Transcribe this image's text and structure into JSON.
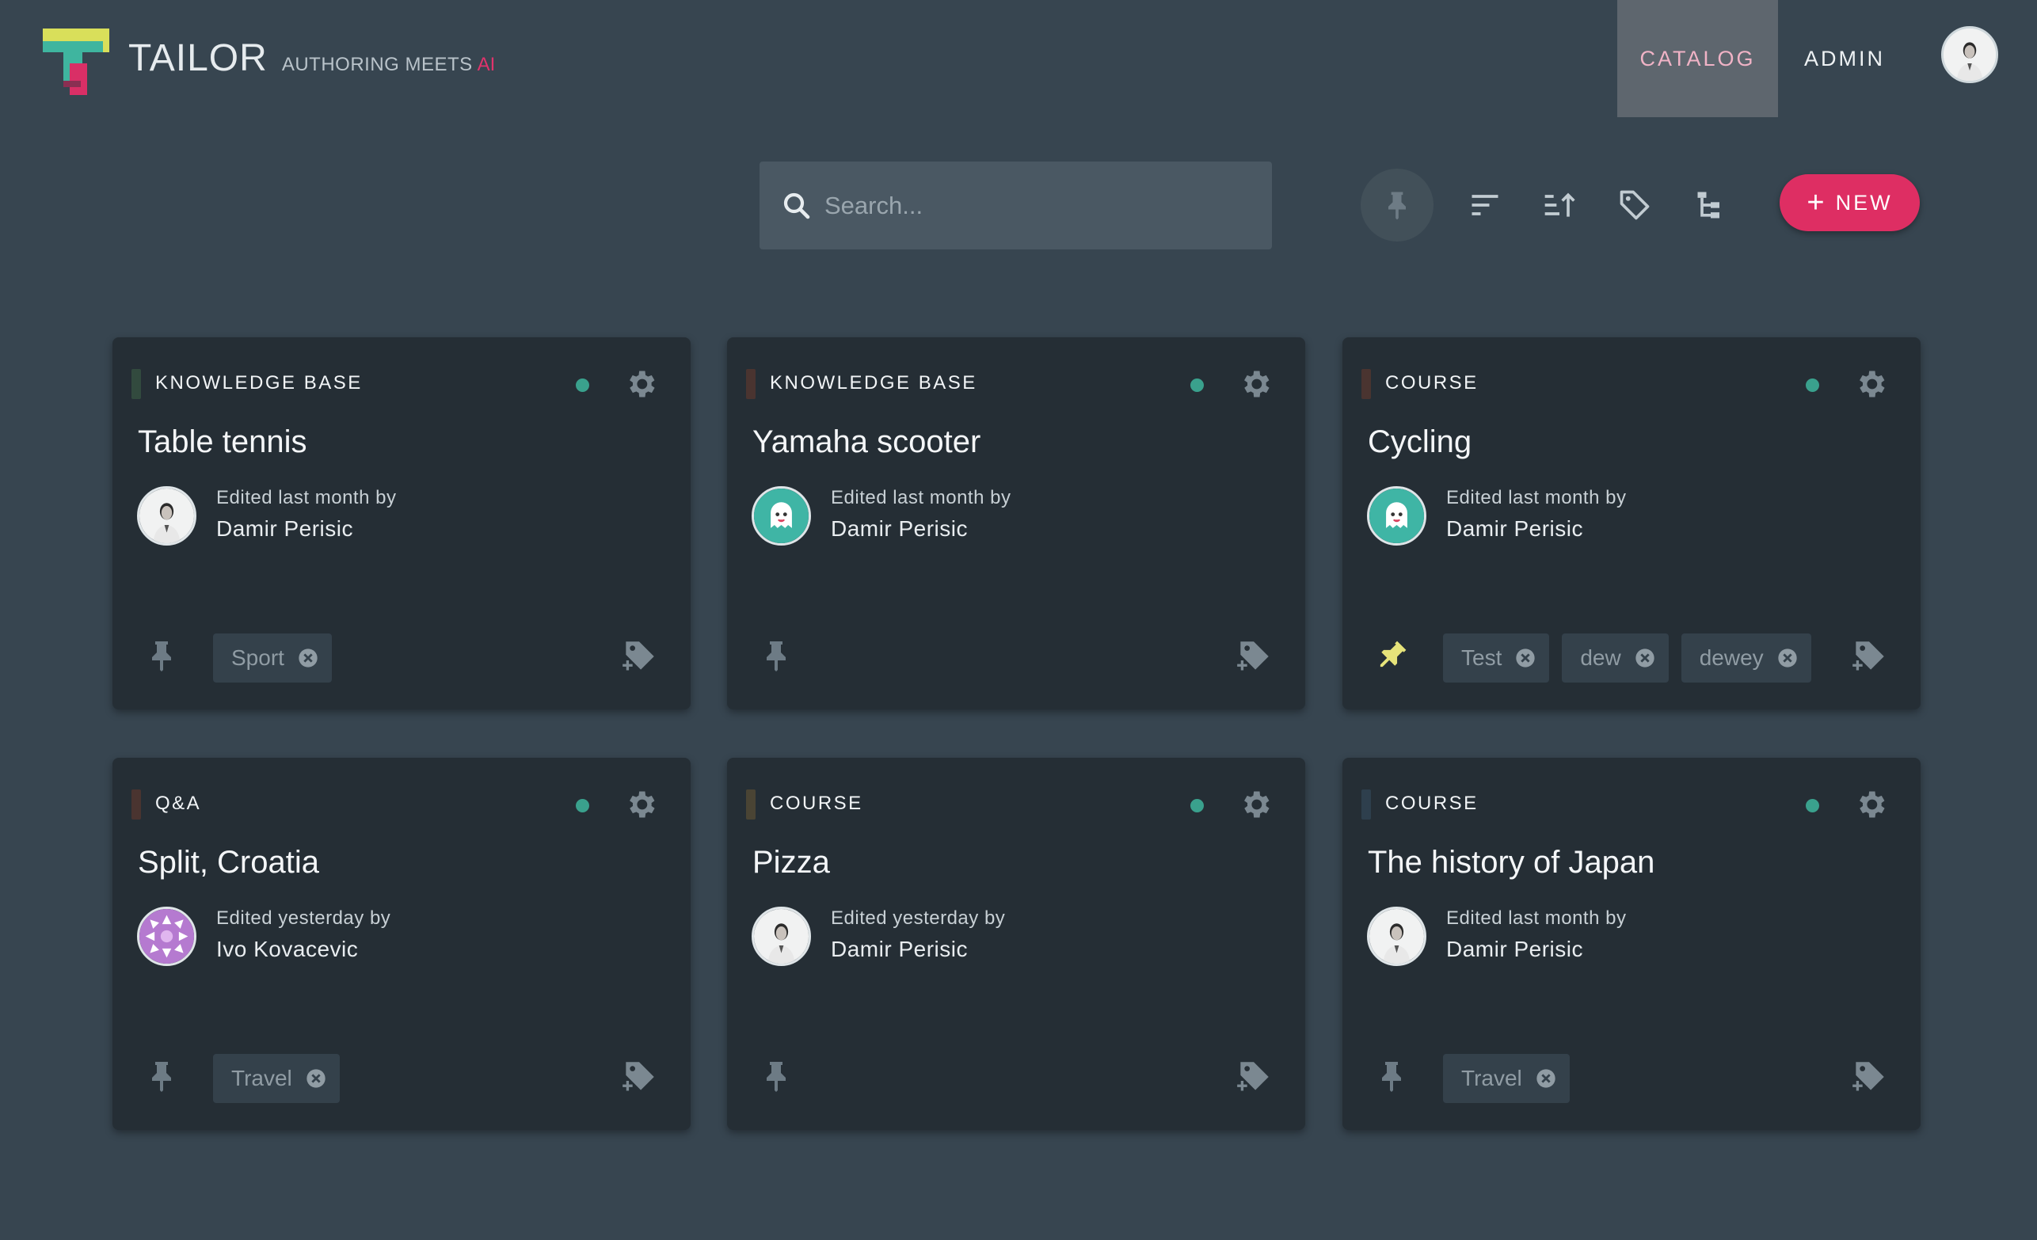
{
  "brand": {
    "name": "TAILOR",
    "tagline": "AUTHORING MEETS",
    "tagline_accent": "AI",
    "colors": {
      "teal": "#3fb59f",
      "yellow": "#d9df5a",
      "pink": "#d92f66"
    }
  },
  "nav": {
    "catalog": "CATALOG",
    "admin": "ADMIN",
    "active": "catalog"
  },
  "search": {
    "placeholder": "Search...",
    "value": ""
  },
  "toolbar": {
    "icons": [
      "pin-filter-icon",
      "sort-icon",
      "sort-order-icon",
      "tag-filter-icon",
      "tree-view-icon"
    ],
    "new_label": "NEW",
    "new_color": "#de2e63"
  },
  "cards": [
    {
      "type": "KNOWLEDGE BASE",
      "type_color": "#324a3e",
      "title": "Table tennis",
      "edited": "Edited last month by",
      "author": "Damir Perisic",
      "avatar": "photo",
      "pinned": false,
      "tags": [
        "Sport"
      ]
    },
    {
      "type": "KNOWLEDGE BASE",
      "type_color": "#4a3430",
      "title": "Yamaha scooter",
      "edited": "Edited last month by",
      "author": "Damir Perisic",
      "avatar": "ghost",
      "pinned": false,
      "tags": []
    },
    {
      "type": "COURSE",
      "type_color": "#4a3430",
      "title": "Cycling",
      "edited": "Edited last month by",
      "author": "Damir Perisic",
      "avatar": "ghost",
      "pinned": true,
      "tags": [
        "Test",
        "dew",
        "dewey"
      ]
    },
    {
      "type": "Q&A",
      "type_color": "#4a3430",
      "title": "Split, Croatia",
      "edited": "Edited yesterday by",
      "author": "Ivo Kovacevic",
      "avatar": "pattern",
      "pinned": false,
      "tags": [
        "Travel"
      ]
    },
    {
      "type": "COURSE",
      "type_color": "#4a4434",
      "title": "Pizza",
      "edited": "Edited yesterday by",
      "author": "Damir Perisic",
      "avatar": "photo",
      "pinned": false,
      "tags": []
    },
    {
      "type": "COURSE",
      "type_color": "#2e3f4d",
      "title": "The history of Japan",
      "edited": "Edited last month by",
      "author": "Damir Perisic",
      "avatar": "photo",
      "pinned": false,
      "tags": [
        "Travel"
      ]
    }
  ]
}
